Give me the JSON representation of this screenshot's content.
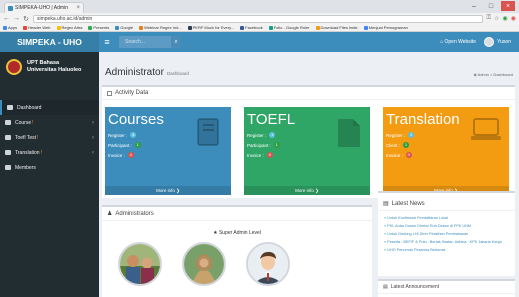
{
  "browser": {
    "tab_title": "SIMPEKA-UHO | Admin",
    "tab_close": "×",
    "url": "simpeka.uho.ac.id/admin",
    "bookmarks": [
      "Apps",
      "Header Web",
      "Regex Attra",
      "Presents",
      "Google",
      "Webinar Regex Ind...",
      "PERF Mock for Every...",
      "Facebook",
      "Folio - Google Ruler",
      "Download Files Indie",
      "Menjual Pemograman"
    ]
  },
  "header": {
    "logo": "SIMPEKA - UHO",
    "menu_glyph": "≡",
    "search_placeholder": "Search...",
    "search_glyph": "⌕",
    "open_website": "Open Website",
    "user_name": "Yuson"
  },
  "sidebar": {
    "org_line1": "UPT Bahasa",
    "org_line2": "Universitas Haluoleo",
    "chevron": "‹",
    "items": [
      {
        "label": "Dashboard",
        "dot": "",
        "chevron": false
      },
      {
        "label": "Course",
        "dot": "!",
        "chevron": true
      },
      {
        "label": "Toefl Test",
        "dot": "!",
        "chevron": true
      },
      {
        "label": "Translation",
        "dot": "!",
        "chevron": true
      },
      {
        "label": "Members",
        "dot": "",
        "chevron": false
      }
    ]
  },
  "page": {
    "title": "Administrator",
    "subtitle": "Dashboard",
    "breadcrumb": "Admin > Dashboard"
  },
  "activity": {
    "heading": "Activity Data",
    "tiles": [
      {
        "title": "Courses",
        "rows": [
          {
            "label": "Register :",
            "value": "3"
          },
          {
            "label": "Participant :",
            "value": "1"
          },
          {
            "label": "Invoice :",
            "value": "4"
          }
        ],
        "more": "More info ❯",
        "color": "#3c8dbc",
        "badge_colors": [
          "#5bc0de",
          "#2e9e3e",
          "#d9534f"
        ]
      },
      {
        "title": "TOEFL",
        "rows": [
          {
            "label": "Register :",
            "value": "1"
          },
          {
            "label": "Participant :",
            "value": "1"
          },
          {
            "label": "Invoice :",
            "value": "0"
          }
        ],
        "more": "More info ❯",
        "color": "#2fa566",
        "badge_colors": [
          "#5bc0de",
          "#2e9e3e",
          "#d9534f"
        ]
      },
      {
        "title": "Translation",
        "rows": [
          {
            "label": "Register :",
            "value": "2"
          },
          {
            "label": "Client :",
            "value": "1"
          },
          {
            "label": "Invoice :",
            "value": "0"
          }
        ],
        "more": "More info ❯",
        "color": "#f39c12",
        "badge_colors": [
          "#5bc0de",
          "#2e9e3e",
          "#d9534f"
        ]
      }
    ]
  },
  "admins": {
    "heading": "Administrators",
    "super_admin": "★ Super Admin Level"
  },
  "latest_news": {
    "heading": "Latest News",
    "items": [
      "» Untuk Konfirmasi Pendaftaran Lokal",
      "» PKL Antar Dosen Direksi Ruh Dekan di FPK UNM",
      "» Untuk Gedung LHI Direr Pelatihan Pembahasan",
      "» Peserta : BEFIF & Putu : Bertak Sastar: Adhina : KPK Jakarta Kanja",
      "» UHO Penumah Pesarma Bertonas"
    ]
  },
  "latest_announce": {
    "heading": "Latest Announcement"
  }
}
